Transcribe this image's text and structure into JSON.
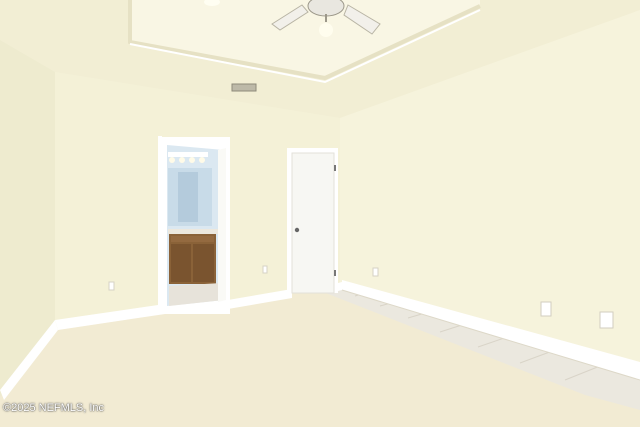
{
  "watermark": {
    "text": "©2025 NEFMLS, Inc"
  },
  "colors": {
    "wall_left": "#efecd0",
    "wall_back": "#f4f1d8",
    "wall_right": "#f6f3dc",
    "ceiling": "#f3efd6",
    "tray": "#f9f6e3",
    "carpet": "#f2ebd2",
    "tile": "#ece9e0",
    "trim": "#ffffff",
    "door": "#f7f7f3",
    "cabinet": "#8a6238",
    "bath_wall": "#d8e6ef"
  }
}
